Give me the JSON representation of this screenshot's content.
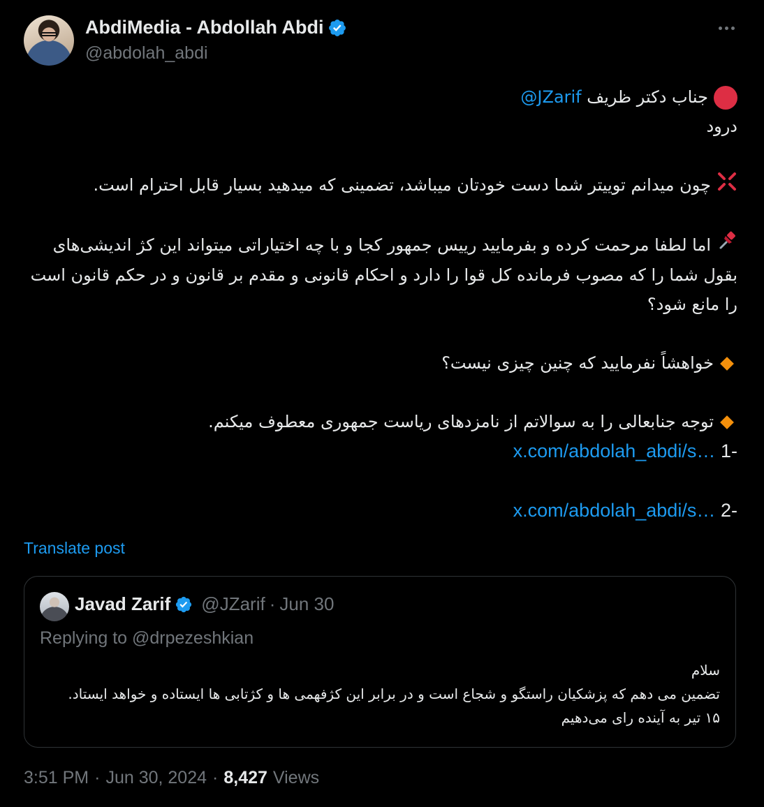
{
  "author": {
    "display_name": "AbdiMedia - Abdollah Abdi",
    "handle": "@abdolah_abdi"
  },
  "post": {
    "line1_text": "جناب دکتر ظریف",
    "line1_mention": "@JZarif",
    "line2": "درود",
    "para1": "چون میدانم توییتر شما دست خودتان میباشد، تضمینی که میدهید بسیار قابل احترام است.",
    "para2": "اما لطفا مرحمت کرده و بفرمایید رییس جمهور کجا و با چه اختیاراتی میتواند این کژ اندیشی‌های بقول شما را که مصوب فرمانده کل قوا را دارد و احکام قانونی و مقدم بر قانون و در حکم قانون است را مانع شود؟",
    "para3": "خواهشاً نفرمایید که چنین چیزی نیست؟",
    "para4": "توجه جنابعالی را به سوالاتم از نامزدهای ریاست جمهوری معطوف میکنم.",
    "item1_prefix": "-1",
    "item1_link": "x.com/abdolah_abdi/s…",
    "item2_prefix": "-2",
    "item2_link": "x.com/abdolah_abdi/s…"
  },
  "translate_label": "Translate post",
  "quote": {
    "display_name": "Javad Zarif",
    "handle": "@JZarif",
    "separator": "·",
    "date": "Jun 30",
    "replying_to": "Replying to @drpezeshkian",
    "line1": "سلام",
    "line2": "تضمین می دهم که پزشکیان راستگو و شجاع است و  در برابر این کژفهمی ها و کژتابی ها ایستاده و خواهد ایستاد.",
    "line3": "۱۵ تیر به آینده رای می‌دهیم"
  },
  "footer": {
    "time": "3:51 PM",
    "sep1": "·",
    "date": "Jun 30, 2024",
    "sep2": "·",
    "views_count": "8,427",
    "views_label": "Views"
  },
  "colors": {
    "background": "#000000",
    "text": "#e7e9ea",
    "muted": "#71767b",
    "link": "#1d9bf0",
    "verified": "#1d9bf0"
  },
  "icons": [
    "verified-badge-icon",
    "more-options-icon",
    "red-circle-emoji",
    "anger-emoji",
    "pushpin-emoji",
    "orange-diamond-emoji"
  ]
}
